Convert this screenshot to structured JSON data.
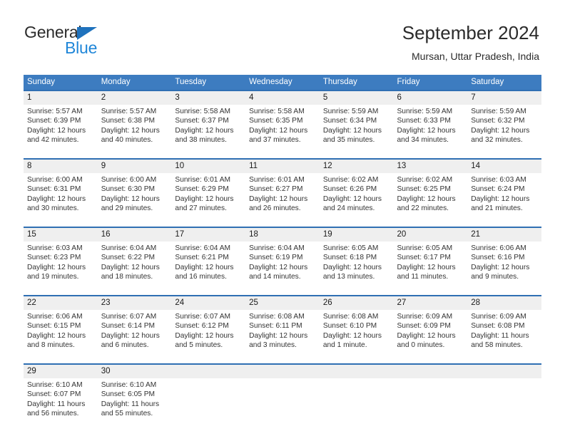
{
  "brand": {
    "name_part1": "General",
    "name_part2": "Blue",
    "flag_icon": "triangle-flag-icon"
  },
  "header": {
    "title": "September 2024",
    "subtitle": "Mursan, Uttar Pradesh, India"
  },
  "colors": {
    "header_blue": "#3d7cc0",
    "week_rule_blue": "#2f6fb3",
    "date_band_gray": "#efefef",
    "brand_blue": "#1f86d8",
    "text": "#333333"
  },
  "weekdays": [
    "Sunday",
    "Monday",
    "Tuesday",
    "Wednesday",
    "Thursday",
    "Friday",
    "Saturday"
  ],
  "weeks": [
    {
      "days": [
        {
          "date": "1",
          "sunrise": "Sunrise: 5:57 AM",
          "sunset": "Sunset: 6:39 PM",
          "daylight_line1": "Daylight: 12 hours",
          "daylight_line2": "and 42 minutes."
        },
        {
          "date": "2",
          "sunrise": "Sunrise: 5:57 AM",
          "sunset": "Sunset: 6:38 PM",
          "daylight_line1": "Daylight: 12 hours",
          "daylight_line2": "and 40 minutes."
        },
        {
          "date": "3",
          "sunrise": "Sunrise: 5:58 AM",
          "sunset": "Sunset: 6:37 PM",
          "daylight_line1": "Daylight: 12 hours",
          "daylight_line2": "and 38 minutes."
        },
        {
          "date": "4",
          "sunrise": "Sunrise: 5:58 AM",
          "sunset": "Sunset: 6:35 PM",
          "daylight_line1": "Daylight: 12 hours",
          "daylight_line2": "and 37 minutes."
        },
        {
          "date": "5",
          "sunrise": "Sunrise: 5:59 AM",
          "sunset": "Sunset: 6:34 PM",
          "daylight_line1": "Daylight: 12 hours",
          "daylight_line2": "and 35 minutes."
        },
        {
          "date": "6",
          "sunrise": "Sunrise: 5:59 AM",
          "sunset": "Sunset: 6:33 PM",
          "daylight_line1": "Daylight: 12 hours",
          "daylight_line2": "and 34 minutes."
        },
        {
          "date": "7",
          "sunrise": "Sunrise: 5:59 AM",
          "sunset": "Sunset: 6:32 PM",
          "daylight_line1": "Daylight: 12 hours",
          "daylight_line2": "and 32 minutes."
        }
      ]
    },
    {
      "days": [
        {
          "date": "8",
          "sunrise": "Sunrise: 6:00 AM",
          "sunset": "Sunset: 6:31 PM",
          "daylight_line1": "Daylight: 12 hours",
          "daylight_line2": "and 30 minutes."
        },
        {
          "date": "9",
          "sunrise": "Sunrise: 6:00 AM",
          "sunset": "Sunset: 6:30 PM",
          "daylight_line1": "Daylight: 12 hours",
          "daylight_line2": "and 29 minutes."
        },
        {
          "date": "10",
          "sunrise": "Sunrise: 6:01 AM",
          "sunset": "Sunset: 6:29 PM",
          "daylight_line1": "Daylight: 12 hours",
          "daylight_line2": "and 27 minutes."
        },
        {
          "date": "11",
          "sunrise": "Sunrise: 6:01 AM",
          "sunset": "Sunset: 6:27 PM",
          "daylight_line1": "Daylight: 12 hours",
          "daylight_line2": "and 26 minutes."
        },
        {
          "date": "12",
          "sunrise": "Sunrise: 6:02 AM",
          "sunset": "Sunset: 6:26 PM",
          "daylight_line1": "Daylight: 12 hours",
          "daylight_line2": "and 24 minutes."
        },
        {
          "date": "13",
          "sunrise": "Sunrise: 6:02 AM",
          "sunset": "Sunset: 6:25 PM",
          "daylight_line1": "Daylight: 12 hours",
          "daylight_line2": "and 22 minutes."
        },
        {
          "date": "14",
          "sunrise": "Sunrise: 6:03 AM",
          "sunset": "Sunset: 6:24 PM",
          "daylight_line1": "Daylight: 12 hours",
          "daylight_line2": "and 21 minutes."
        }
      ]
    },
    {
      "days": [
        {
          "date": "15",
          "sunrise": "Sunrise: 6:03 AM",
          "sunset": "Sunset: 6:23 PM",
          "daylight_line1": "Daylight: 12 hours",
          "daylight_line2": "and 19 minutes."
        },
        {
          "date": "16",
          "sunrise": "Sunrise: 6:04 AM",
          "sunset": "Sunset: 6:22 PM",
          "daylight_line1": "Daylight: 12 hours",
          "daylight_line2": "and 18 minutes."
        },
        {
          "date": "17",
          "sunrise": "Sunrise: 6:04 AM",
          "sunset": "Sunset: 6:21 PM",
          "daylight_line1": "Daylight: 12 hours",
          "daylight_line2": "and 16 minutes."
        },
        {
          "date": "18",
          "sunrise": "Sunrise: 6:04 AM",
          "sunset": "Sunset: 6:19 PM",
          "daylight_line1": "Daylight: 12 hours",
          "daylight_line2": "and 14 minutes."
        },
        {
          "date": "19",
          "sunrise": "Sunrise: 6:05 AM",
          "sunset": "Sunset: 6:18 PM",
          "daylight_line1": "Daylight: 12 hours",
          "daylight_line2": "and 13 minutes."
        },
        {
          "date": "20",
          "sunrise": "Sunrise: 6:05 AM",
          "sunset": "Sunset: 6:17 PM",
          "daylight_line1": "Daylight: 12 hours",
          "daylight_line2": "and 11 minutes."
        },
        {
          "date": "21",
          "sunrise": "Sunrise: 6:06 AM",
          "sunset": "Sunset: 6:16 PM",
          "daylight_line1": "Daylight: 12 hours",
          "daylight_line2": "and 9 minutes."
        }
      ]
    },
    {
      "days": [
        {
          "date": "22",
          "sunrise": "Sunrise: 6:06 AM",
          "sunset": "Sunset: 6:15 PM",
          "daylight_line1": "Daylight: 12 hours",
          "daylight_line2": "and 8 minutes."
        },
        {
          "date": "23",
          "sunrise": "Sunrise: 6:07 AM",
          "sunset": "Sunset: 6:14 PM",
          "daylight_line1": "Daylight: 12 hours",
          "daylight_line2": "and 6 minutes."
        },
        {
          "date": "24",
          "sunrise": "Sunrise: 6:07 AM",
          "sunset": "Sunset: 6:12 PM",
          "daylight_line1": "Daylight: 12 hours",
          "daylight_line2": "and 5 minutes."
        },
        {
          "date": "25",
          "sunrise": "Sunrise: 6:08 AM",
          "sunset": "Sunset: 6:11 PM",
          "daylight_line1": "Daylight: 12 hours",
          "daylight_line2": "and 3 minutes."
        },
        {
          "date": "26",
          "sunrise": "Sunrise: 6:08 AM",
          "sunset": "Sunset: 6:10 PM",
          "daylight_line1": "Daylight: 12 hours",
          "daylight_line2": "and 1 minute."
        },
        {
          "date": "27",
          "sunrise": "Sunrise: 6:09 AM",
          "sunset": "Sunset: 6:09 PM",
          "daylight_line1": "Daylight: 12 hours",
          "daylight_line2": "and 0 minutes."
        },
        {
          "date": "28",
          "sunrise": "Sunrise: 6:09 AM",
          "sunset": "Sunset: 6:08 PM",
          "daylight_line1": "Daylight: 11 hours",
          "daylight_line2": "and 58 minutes."
        }
      ]
    },
    {
      "days": [
        {
          "date": "29",
          "sunrise": "Sunrise: 6:10 AM",
          "sunset": "Sunset: 6:07 PM",
          "daylight_line1": "Daylight: 11 hours",
          "daylight_line2": "and 56 minutes."
        },
        {
          "date": "30",
          "sunrise": "Sunrise: 6:10 AM",
          "sunset": "Sunset: 6:05 PM",
          "daylight_line1": "Daylight: 11 hours",
          "daylight_line2": "and 55 minutes."
        },
        {
          "date": "",
          "sunrise": "",
          "sunset": "",
          "daylight_line1": "",
          "daylight_line2": ""
        },
        {
          "date": "",
          "sunrise": "",
          "sunset": "",
          "daylight_line1": "",
          "daylight_line2": ""
        },
        {
          "date": "",
          "sunrise": "",
          "sunset": "",
          "daylight_line1": "",
          "daylight_line2": ""
        },
        {
          "date": "",
          "sunrise": "",
          "sunset": "",
          "daylight_line1": "",
          "daylight_line2": ""
        },
        {
          "date": "",
          "sunrise": "",
          "sunset": "",
          "daylight_line1": "",
          "daylight_line2": ""
        }
      ]
    }
  ]
}
